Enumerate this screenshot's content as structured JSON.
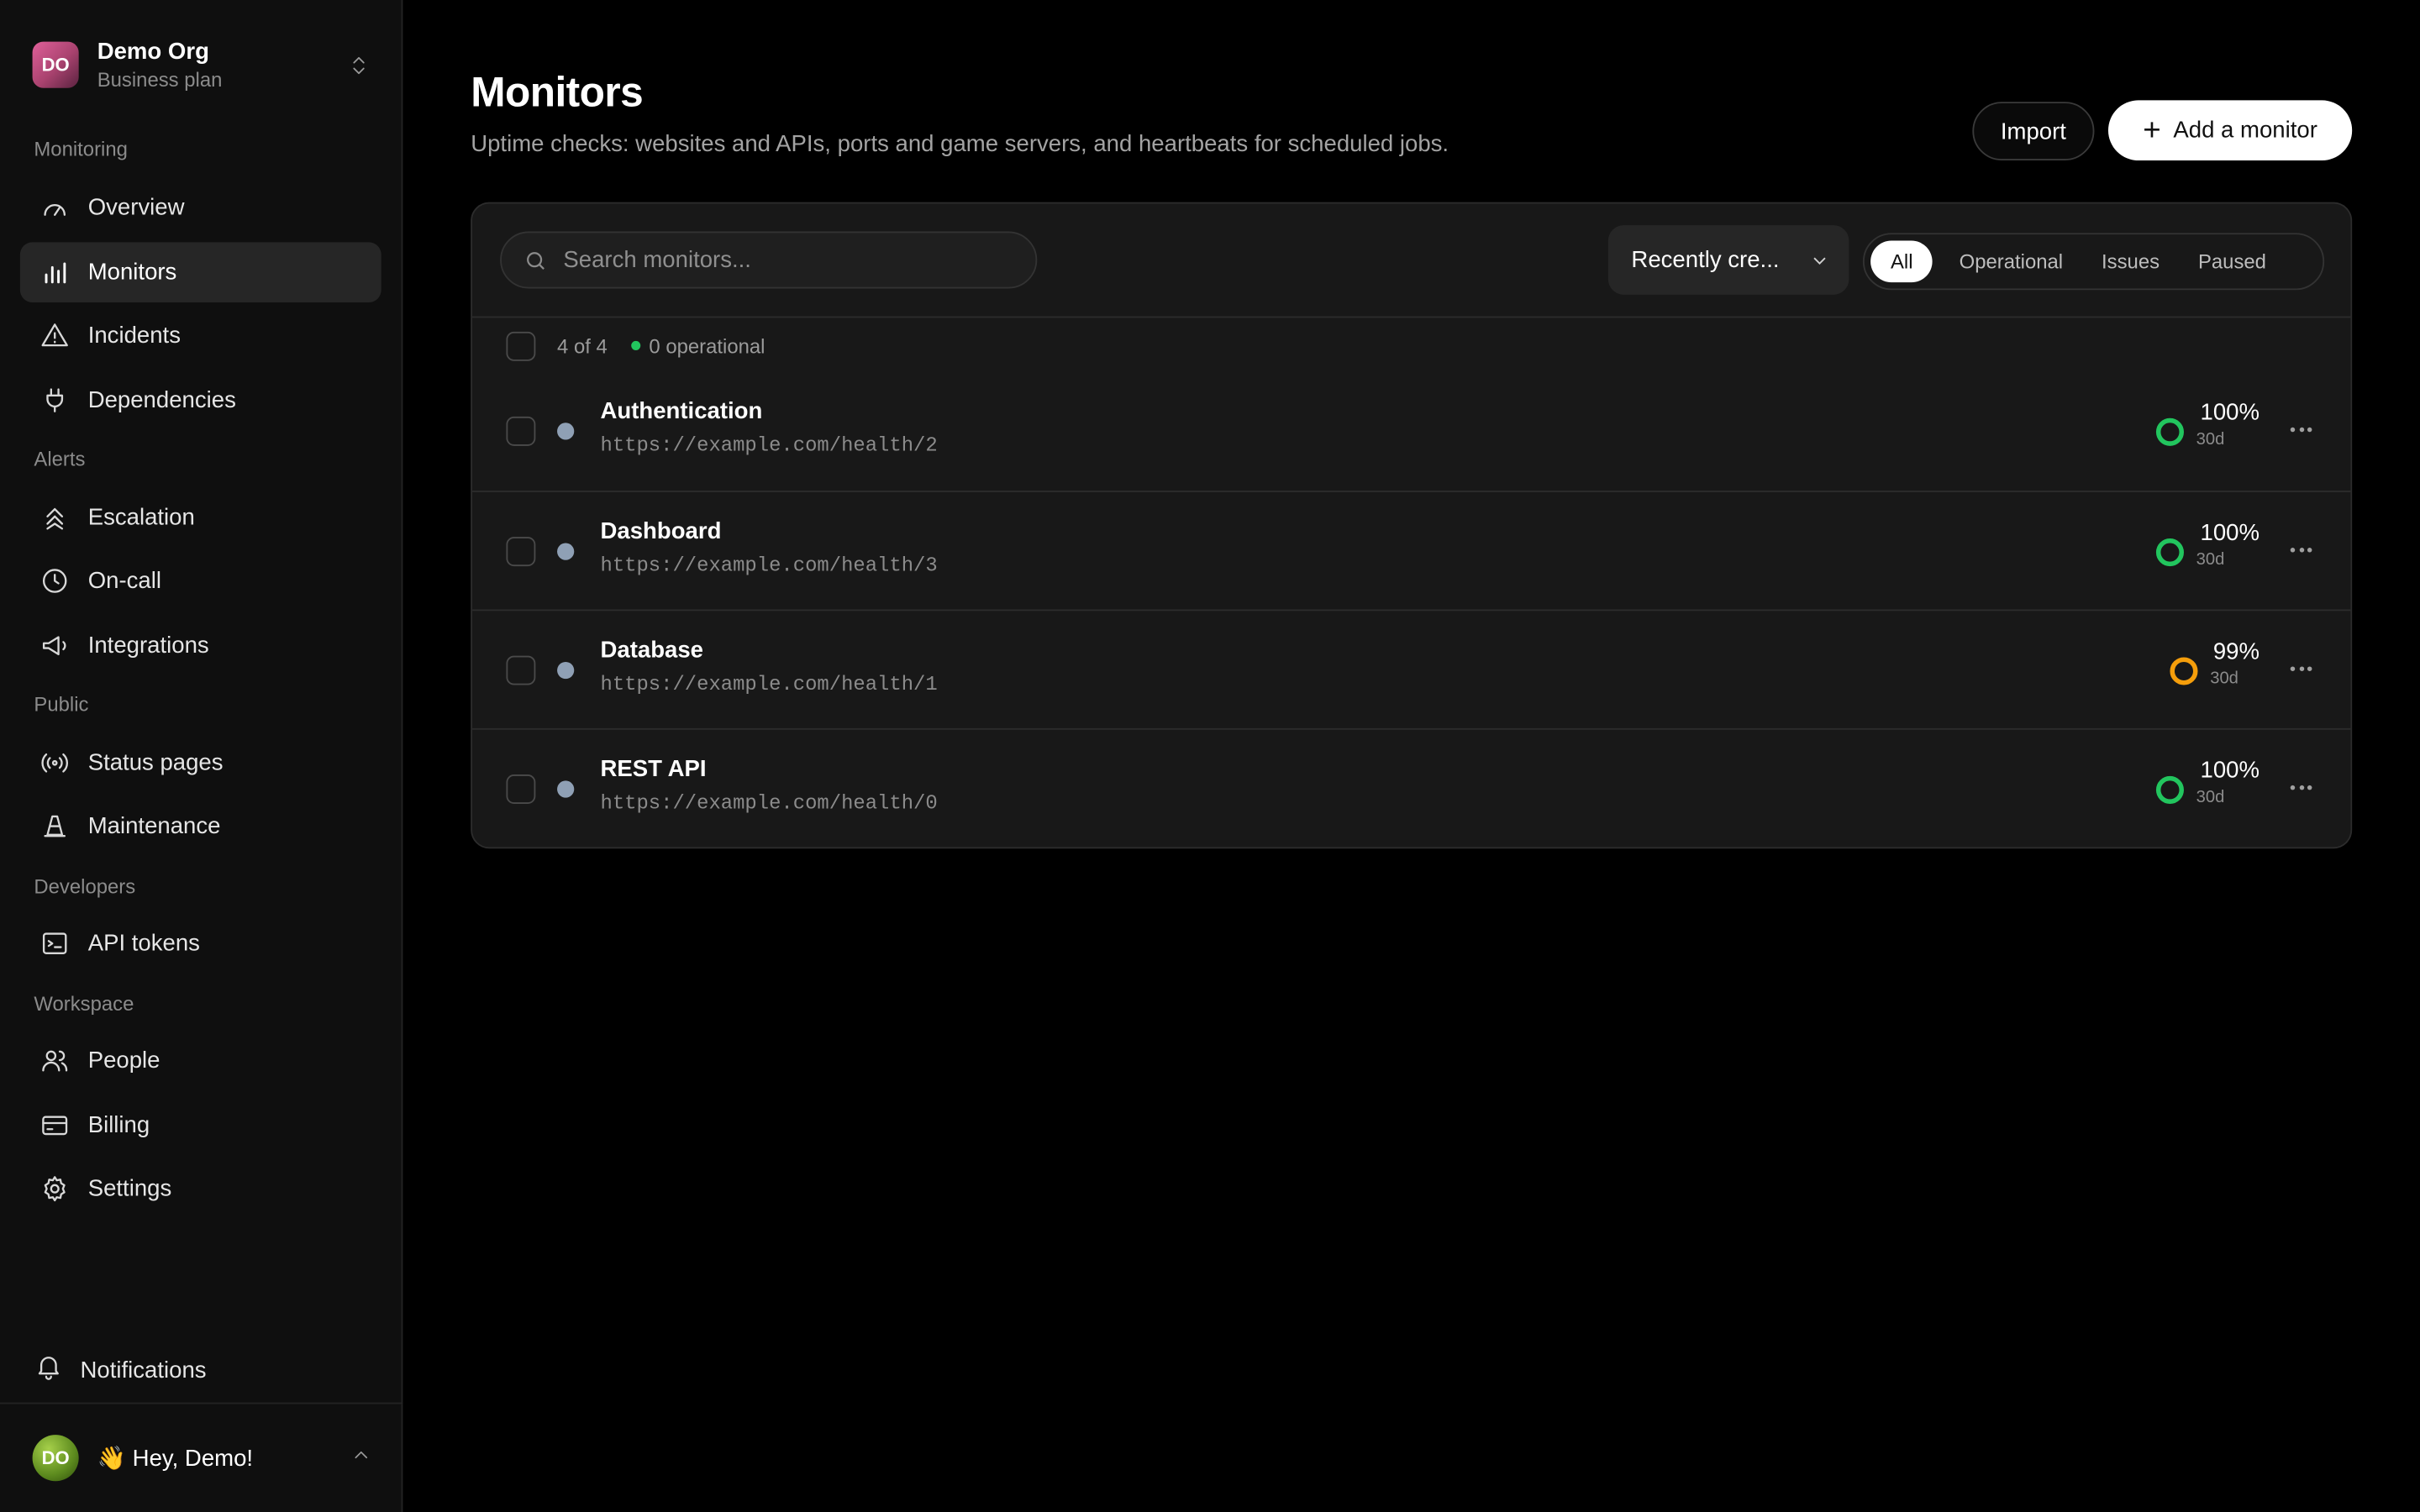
{
  "org": {
    "initials": "DO",
    "name": "Demo Org",
    "plan": "Business plan"
  },
  "sidebar": {
    "sections": [
      "Monitoring",
      "Alerts",
      "Public",
      "Developers",
      "Workspace"
    ],
    "items": [
      {
        "label": "Overview",
        "icon": "gauge-icon"
      },
      {
        "label": "Monitors",
        "icon": "bar-chart-icon",
        "active": true
      },
      {
        "label": "Incidents",
        "icon": "warning-triangle-icon"
      },
      {
        "label": "Dependencies",
        "icon": "plug-icon"
      },
      {
        "label": "Escalation",
        "icon": "chevrons-up-icon"
      },
      {
        "label": "On-call",
        "icon": "clock-icon"
      },
      {
        "label": "Integrations",
        "icon": "megaphone-icon"
      },
      {
        "label": "Status pages",
        "icon": "broadcast-icon"
      },
      {
        "label": "Maintenance",
        "icon": "traffic-cone-icon"
      },
      {
        "label": "API tokens",
        "icon": "terminal-icon"
      },
      {
        "label": "People",
        "icon": "users-icon"
      },
      {
        "label": "Billing",
        "icon": "credit-card-icon"
      },
      {
        "label": "Settings",
        "icon": "gear-icon"
      }
    ],
    "notifications": "Notifications",
    "user": {
      "initials": "DO",
      "greeting": "👋 Hey, Demo!"
    }
  },
  "page": {
    "title": "Monitors",
    "subtitle": "Uptime checks: websites and APIs, ports and game servers, and heartbeats for scheduled jobs.",
    "import_label": "Import",
    "add_label": "Add a monitor"
  },
  "toolbar": {
    "search_placeholder": "Search monitors...",
    "sort_label": "Recently cre...",
    "filters": [
      "All",
      "Operational",
      "Issues",
      "Paused"
    ],
    "active_filter": "All"
  },
  "summary": {
    "count": "4 of 4",
    "operational": "0 operational"
  },
  "monitors": [
    {
      "name": "Authentication",
      "url": "https://example.com/health/2",
      "uptime": "100%",
      "period": "30d",
      "ring_color": "#22c55e"
    },
    {
      "name": "Dashboard",
      "url": "https://example.com/health/3",
      "uptime": "100%",
      "period": "30d",
      "ring_color": "#22c55e"
    },
    {
      "name": "Database",
      "url": "https://example.com/health/1",
      "uptime": "99%",
      "period": "30d",
      "ring_color": "#f59e0b"
    },
    {
      "name": "REST API",
      "url": "https://example.com/health/0",
      "uptime": "100%",
      "period": "30d",
      "ring_color": "#22c55e"
    }
  ]
}
